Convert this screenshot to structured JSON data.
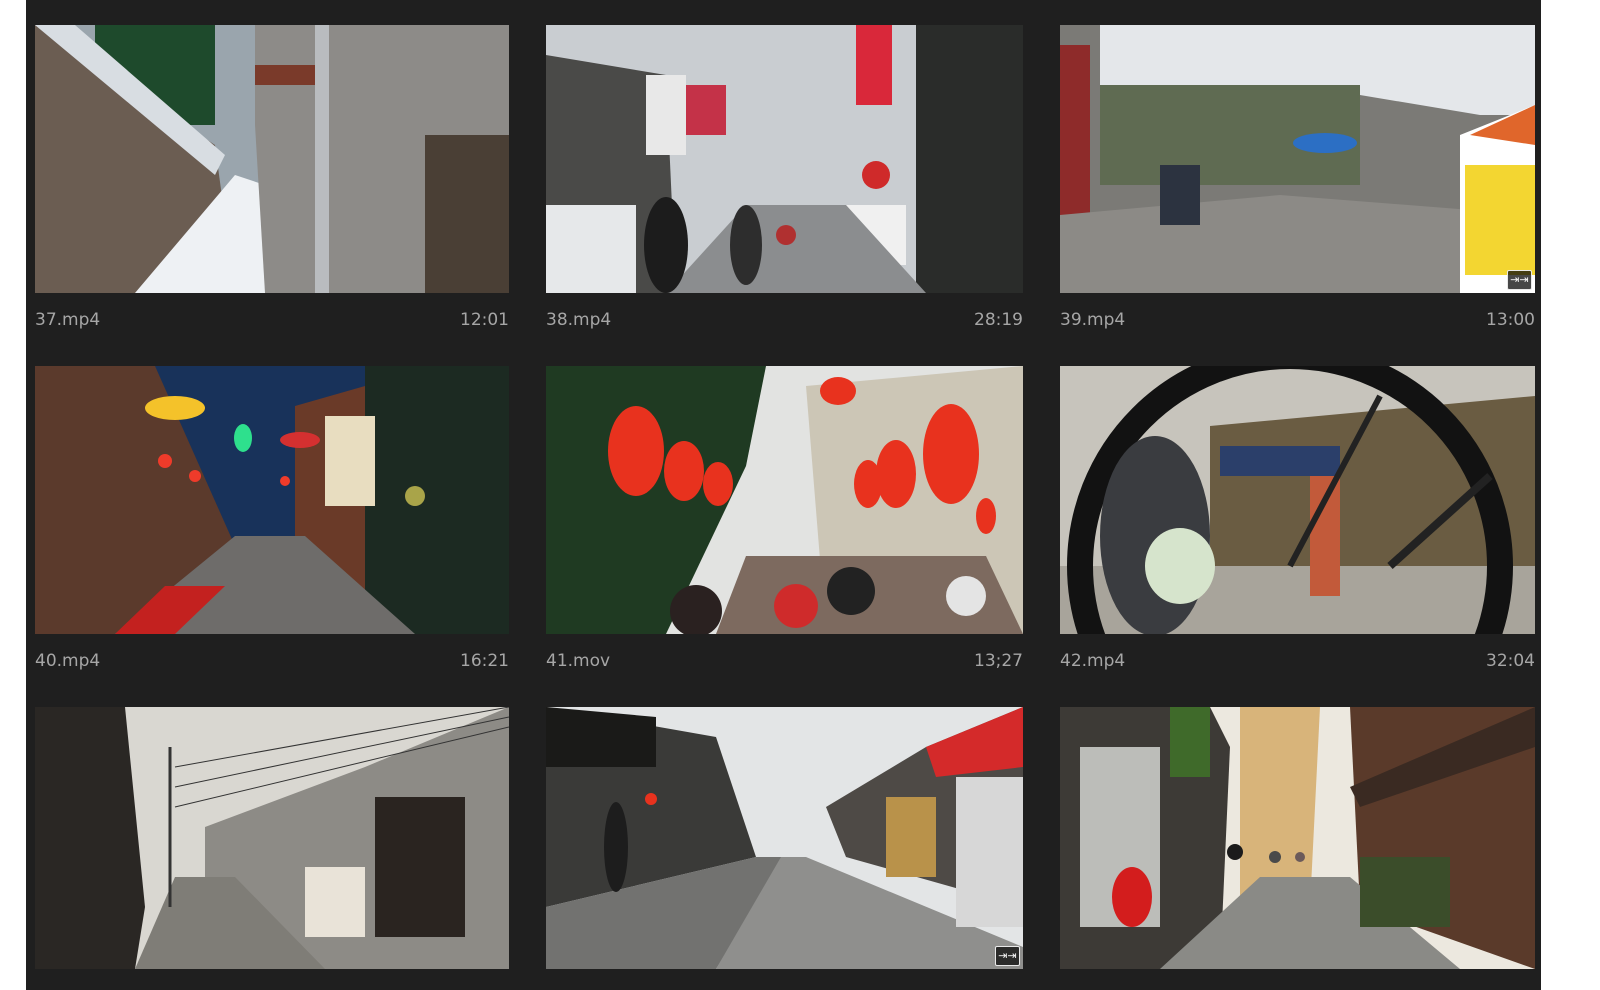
{
  "clips": [
    {
      "name": "37.mp4",
      "duration": "12:01",
      "scene": "snowy-alley-stone-wall",
      "badge": false
    },
    {
      "name": "38.mp4",
      "duration": "28:19",
      "scene": "market-street-red-signs",
      "badge": false
    },
    {
      "name": "39.mp4",
      "duration": "13:00",
      "scene": "hutong-courtyard-umbrella",
      "badge": true
    },
    {
      "name": "40.mp4",
      "duration": "16:21",
      "scene": "night-street-lanterns",
      "badge": false
    },
    {
      "name": "41.mov",
      "duration": "13;27",
      "scene": "red-lanterns-crowd",
      "badge": false
    },
    {
      "name": "42.mp4",
      "duration": "32:04",
      "scene": "bicycle-wheel-pedestrian",
      "badge": false
    },
    {
      "name": "",
      "duration": "",
      "scene": "old-alley-power-lines",
      "badge": false
    },
    {
      "name": "",
      "duration": "",
      "scene": "pedestrian-street-shops",
      "badge": true
    },
    {
      "name": "",
      "duration": "",
      "scene": "narrow-european-street",
      "badge": false
    }
  ],
  "badge_icon": "effect-icon",
  "badge_glyph": "⇥⇥",
  "colors": {
    "panel_background": "#1f1f1f",
    "label_text": "#a6a6a6",
    "lantern_red": "#e8321e"
  }
}
